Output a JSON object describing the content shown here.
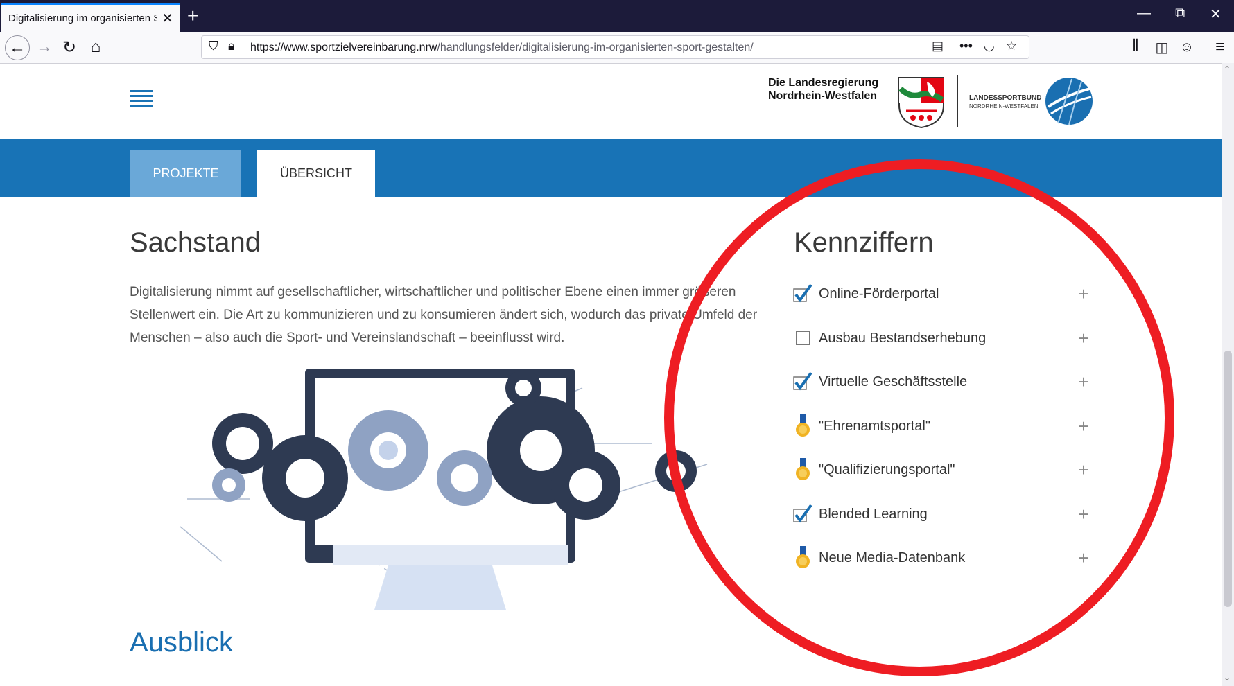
{
  "browser": {
    "tab_title": "Digitalisierung im organisierten Sport gestalten",
    "url_host": "https://www.sportzielvereinbarung.nrw",
    "url_path": "/handlungsfelder/digitalisierung-im-organisierten-sport-gestalten/"
  },
  "header": {
    "lr_line1": "Die Landesregierung",
    "lr_line2": "Nordrhein-Westfalen",
    "lsb_line1": "LANDESSPORTBUND",
    "lsb_line2": "NORDRHEIN-WESTFALEN"
  },
  "tabs": [
    {
      "label": "PROJEKTE"
    },
    {
      "label": "ÜBERSICHT"
    }
  ],
  "sachstand": {
    "heading": "Sachstand",
    "text": "Digitalisierung nimmt auf gesellschaftlicher, wirtschaftlicher und politischer Ebene einen immer größeren Stellenwert ein. Die Art zu kommunizieren und zu konsumieren ändert sich, wodurch das private Umfeld der Menschen – also auch die Sport- und Vereinslandschaft – beeinflusst wird."
  },
  "ausblick": {
    "heading": "Ausblick"
  },
  "kennziffern": {
    "heading": "Kennziffern",
    "items": [
      {
        "label": "Online-Förderportal",
        "status": "check"
      },
      {
        "label": "Ausbau Bestandserhebung",
        "status": "empty"
      },
      {
        "label": "Virtuelle Geschäftsstelle",
        "status": "check"
      },
      {
        "label": "\"Ehrenamtsportal\"",
        "status": "medal"
      },
      {
        "label": "\"Qualifizierungsportal\"",
        "status": "medal"
      },
      {
        "label": "Blended Learning",
        "status": "check"
      },
      {
        "label": "Neue Media-Datenbank",
        "status": "medal"
      }
    ]
  },
  "colors": {
    "accent_blue": "#1873b6",
    "tab_light_blue": "#6aa8d8",
    "annotation_red": "#ee1d23"
  }
}
